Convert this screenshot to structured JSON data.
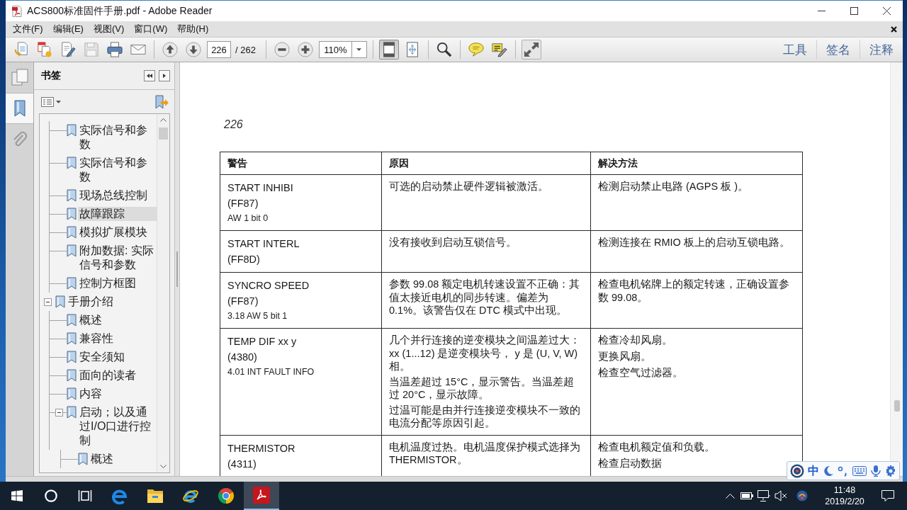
{
  "window": {
    "title": "ACS800标准固件手册.pdf - Adobe Reader"
  },
  "menu": [
    "文件(F)",
    "编辑(E)",
    "视图(V)",
    "窗口(W)",
    "帮助(H)"
  ],
  "toolbar": {
    "save": {
      "disabled": true
    },
    "page_field": {
      "value": "226"
    },
    "page_count": "/ 262",
    "zoom_field": {
      "value": "110%"
    },
    "fit_page": {
      "selected": true
    },
    "fit_width": {
      "selected": false
    },
    "panes": [
      "工具",
      "签名",
      "注释"
    ]
  },
  "nav_pane": {
    "buttons": [
      {
        "kind": "pages",
        "selected": false
      },
      {
        "kind": "bookmarks",
        "selected": true
      },
      {
        "kind": "attachments",
        "selected": false
      }
    ]
  },
  "bookmarks": {
    "title": "书签",
    "items": [
      {
        "children": [
          {
            "label": "实际信号和参数",
            "selected": false
          },
          {
            "label": "实际信号和参数",
            "selected": false
          },
          {
            "label": "现场总线控制",
            "selected": false
          },
          {
            "label": "故障跟踪",
            "selected": true
          },
          {
            "label": "模拟扩展模块",
            "selected": false
          },
          {
            "label": "附加数据: 实际信号和参数",
            "selected": false
          },
          {
            "label": "控制方框图",
            "selected": false
          }
        ]
      },
      {
        "label": "手册介绍",
        "selected": false,
        "expanded": true,
        "children": [
          {
            "label": "概述",
            "selected": false
          },
          {
            "label": "兼容性",
            "selected": false
          },
          {
            "label": "安全须知",
            "selected": false
          },
          {
            "label": "面向的读者",
            "selected": false
          },
          {
            "label": "内容",
            "selected": false
          },
          {
            "label": "启动；以及通过I/O口进行控制",
            "selected": false,
            "expanded": true,
            "children": [
              {
                "label": "概述",
                "selected": false
              }
            ]
          }
        ]
      }
    ]
  },
  "document": {
    "page_number": "226",
    "table": {
      "columns": [
        "警告",
        "原因",
        "解决方法"
      ],
      "rows": [
        {
          "warning": [
            "START INHIBI",
            "(FF87)"
          ],
          "note": "AW 1 bit 0",
          "cause": [
            "可选的启动禁止硬件逻辑被激活。"
          ],
          "remedy": [
            "检测启动禁止电路 (AGPS 板 )。"
          ]
        },
        {
          "warning": [
            "START INTERL",
            "(FF8D)"
          ],
          "cause": [
            "没有接收到启动互锁信号。"
          ],
          "remedy": [
            "检测连接在 RMIO 板上的启动互锁电路。"
          ]
        },
        {
          "warning": [
            "SYNCRO SPEED",
            "(FF87)"
          ],
          "note": "3.18 AW 5 bit 1",
          "cause": [
            "参数 99.08 额定电机转速设置不正确：其值太接近电机的同步转速。偏差为 0.1%。该警告仅在 DTC 模式中出现。"
          ],
          "remedy": [
            "检查电机铭牌上的额定转速，正确设置参数 99.08。"
          ]
        },
        {
          "warning": [
            "TEMP DIF xx y",
            "(4380)"
          ],
          "note": "4.01 INT FAULT INFO",
          "cause": [
            "几个并行连接的逆变模块之间温差过大：xx (1...12) 是逆变模块号， y 是 (U, V, W) 相。",
            "当温差超过 15°C，显示警告。当温差超过 20°C，显示故障。",
            "过温可能是由并行连接逆变模块不一致的电流分配等原因引起。"
          ],
          "remedy": [
            "检查冷却风扇。",
            "更换风扇。",
            "检查空气过滤器。"
          ]
        },
        {
          "warning": [
            "THERMISTOR",
            "(4311)"
          ],
          "cause": [
            "电机温度过热。电机温度保护模式选择为 THERMISTOR。"
          ],
          "remedy": [
            "检查电机额定值和负载。",
            "检查启动数据"
          ]
        }
      ]
    }
  },
  "ime_bar": {
    "mode": "中"
  },
  "taskbar": {
    "apps": [
      {
        "kind": "browser",
        "selected": false
      },
      {
        "kind": "folder",
        "selected": false
      },
      {
        "kind": "globe",
        "selected": false
      },
      {
        "kind": "ball",
        "selected": false
      },
      {
        "kind": "pdf",
        "selected": true
      }
    ],
    "clock": {
      "time": "11:48",
      "date": "2019/2/20"
    }
  }
}
